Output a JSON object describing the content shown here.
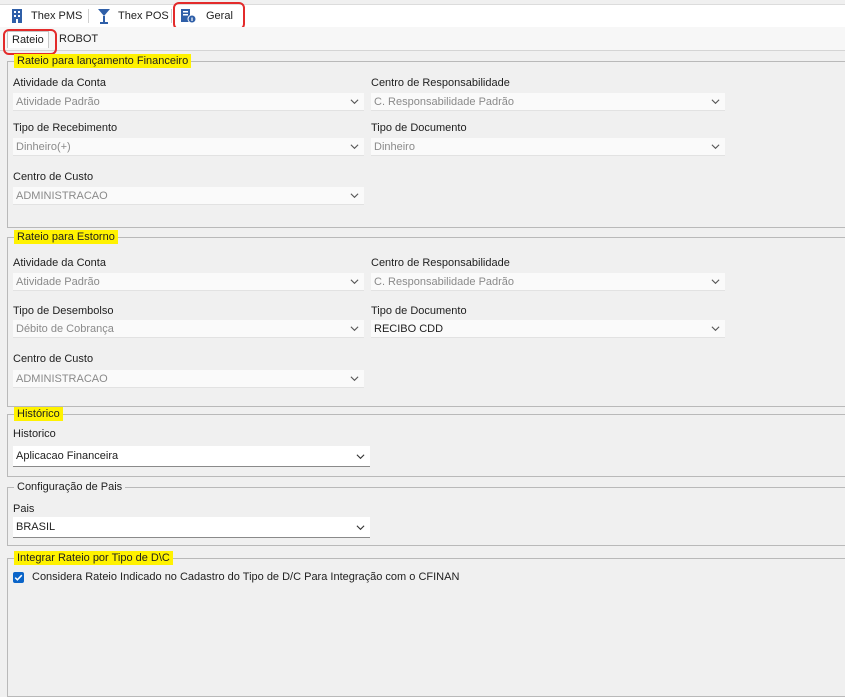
{
  "top_tabs": {
    "pms": "Thex PMS",
    "pos": "Thex POS",
    "geral": "Geral"
  },
  "sub_tabs": {
    "rateio": "Rateio",
    "robot": "ROBOT"
  },
  "group_lancamento": {
    "title": "Rateio para lançamento Financeiro",
    "atividade_label": "Atividade da Conta",
    "atividade_value": "Atividade Padrão",
    "centro_resp_label": "Centro de Responsabilidade",
    "centro_resp_value": "C. Responsabilidade Padrão",
    "tipo_receb_label": "Tipo de Recebimento",
    "tipo_receb_value": "Dinheiro(+)",
    "tipo_doc_label": "Tipo de Documento",
    "tipo_doc_value": "Dinheiro",
    "centro_custo_label": "Centro de Custo",
    "centro_custo_value": "ADMINISTRACAO"
  },
  "group_estorno": {
    "title": "Rateio para Estorno",
    "atividade_label": "Atividade da Conta",
    "atividade_value": "Atividade Padrão",
    "centro_resp_label": "Centro de Responsabilidade",
    "centro_resp_value": "C. Responsabilidade Padrão",
    "tipo_desemb_label": "Tipo de Desembolso",
    "tipo_desemb_value": "Débito de Cobrança",
    "tipo_doc_label": "Tipo de Documento",
    "tipo_doc_value": "RECIBO CDD",
    "centro_custo_label": "Centro de Custo",
    "centro_custo_value": "ADMINISTRACAO"
  },
  "group_historico": {
    "title": "Histórico",
    "label": "Historico",
    "value": "Aplicacao Financeira"
  },
  "group_pais": {
    "title": "Configuração de Pais",
    "label": "Pais",
    "value": "BRASIL"
  },
  "group_integrar": {
    "title": "Integrar Rateio por Tipo de D\\C",
    "checkbox_label": "Considera Rateio Indicado no Cadastro do Tipo de D/C Para Integração com o CFINAN",
    "checked": true
  },
  "colors": {
    "highlight": "#fff200",
    "annotation_red": "#e32b2b",
    "checkbox_blue": "#0a64c8",
    "pms_icon": "#2f5fa8"
  },
  "icons": [
    "building-icon",
    "cocktail-icon",
    "settings-document-icon",
    "chevron-down-icon",
    "checkmark-icon"
  ]
}
